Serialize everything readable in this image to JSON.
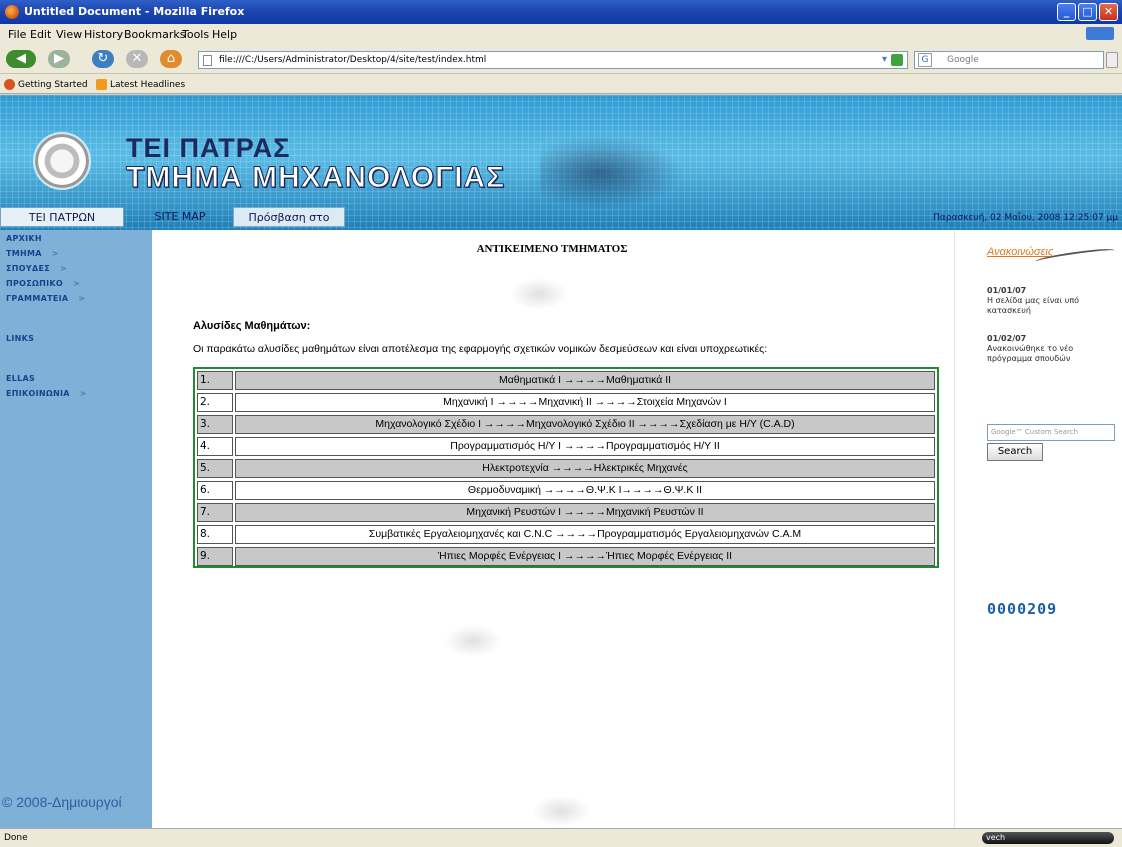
{
  "window": {
    "title": "Untitled Document - Mozilla Firefox",
    "min_glyph": "_",
    "max_glyph": "□",
    "close_glyph": "✕"
  },
  "menu": [
    "File",
    "Edit",
    "View",
    "History",
    "Bookmarks",
    "Tools",
    "Help"
  ],
  "nav": {
    "back_glyph": "◀",
    "forward_glyph": "▶",
    "reload_glyph": "↻",
    "stop_glyph": "✕",
    "home_glyph": "⌂",
    "url": "file:///C:/Users/Administrator/Desktop/4/site/test/index.html",
    "search_engine_glyph": "G",
    "search_placeholder": "Google"
  },
  "bookmarks": [
    "Getting Started",
    "Latest Headlines"
  ],
  "banner": {
    "line1": "ΤΕΙ ΠΑΤΡΑΣ",
    "line2": "ΤΜΗΜΑ ΜΗΧΑΝΟΛΟΓΙΑΣ"
  },
  "topnav": {
    "link1": "ΤΕΙ ΠΑΤΡΩΝ",
    "link2": "SITE MAP",
    "link3": "Πρόσβαση στο Τμήμα",
    "date": "Παρασκευή, 02 Μαΐου, 2008 12:25:07 μμ"
  },
  "sidebar": {
    "items": [
      {
        "label": "ΑΡΧΙΚΗ",
        "arrow": ""
      },
      {
        "label": "ΤΜΗΜΑ",
        "arrow": ">"
      },
      {
        "label": "ΣΠΟΥΔΕΣ",
        "arrow": ">"
      },
      {
        "label": "ΠΡΟΣΩΠΙΚΟ",
        "arrow": ">"
      },
      {
        "label": "ΓΡΑΜΜΑΤΕΙΑ",
        "arrow": ">"
      },
      {
        "label": "LINKS",
        "arrow": ""
      },
      {
        "label": "ELLAS",
        "arrow": ""
      },
      {
        "label": "ΕΠΙΚΟΙΝΩΝΙΑ",
        "arrow": ">"
      }
    ],
    "copyright": "© 2008-Δημιουργοί"
  },
  "main": {
    "heading": "ΑΝΤΙΚΕΙΜΕΝΟ ΤΜΗΜΑΤΟΣ",
    "subheading": "Αλυσίδες Μαθημάτων:",
    "intro": "Οι παρακάτω αλυσίδες μαθημάτων είναι αποτέλεσμα της εφαρμογής σχετικών νομικών δεσμεύσεων και είναι υποχρεωτικές:",
    "chains": [
      {
        "num": "1.",
        "text": "Μαθηματικά Ι →→→→Μαθηματικά ΙΙ"
      },
      {
        "num": "2.",
        "text": "Μηχανική Ι →→→→Μηχανική ΙΙ →→→→Στοιχεία Μηχανών Ι"
      },
      {
        "num": "3.",
        "text": "Μηχανολογικό Σχέδιο Ι →→→→Μηχανολογικό Σχέδιο ΙΙ →→→→Σχεδίαση με Η/Υ (C.A.D)"
      },
      {
        "num": "4.",
        "text": "Προγραμματισμός Η/Υ Ι →→→→Προγραμματισμός Η/Υ ΙΙ"
      },
      {
        "num": "5.",
        "text": "Ηλεκτροτεχνία →→→→Ηλεκτρικές Μηχανές"
      },
      {
        "num": "6.",
        "text": "Θερμοδυναμική →→→→Θ.Ψ.Κ Ι→→→→Θ.Ψ.Κ ΙΙ"
      },
      {
        "num": "7.",
        "text": "Μηχανική Ρευστών Ι →→→→Μηχανική Ρευστών ΙΙ"
      },
      {
        "num": "8.",
        "text": "Συμβατικές Εργαλειομηχανές και C.N.C →→→→Προγραμματισμός Εργαλειομηχανών C.A.M"
      },
      {
        "num": "9.",
        "text": "Ήπιες Μορφές Ενέργειας Ι →→→→Ήπιες Μορφές Ενέργειας ΙΙ"
      }
    ]
  },
  "right": {
    "announcements_title": "Ανακοινώσεις",
    "items": [
      {
        "date": "01/01/07",
        "text": "Η σελίδα μας είναι υπό κατασκευή"
      },
      {
        "date": "01/02/07",
        "text": "Ανακοινώθηκε το νέο πρόγραμμα σπουδών"
      }
    ],
    "search_placeholder": "Google™ Custom Search",
    "search_button": "Search",
    "counter": "0000209"
  },
  "status": {
    "text": "Done",
    "pill": "vech"
  },
  "colors": {
    "sidebar": "#7fb0d8",
    "banner": "#3aa5d9",
    "table_border": "#1f8d2b",
    "announce": "#d97c1c",
    "counter": "#1c5fa3"
  }
}
